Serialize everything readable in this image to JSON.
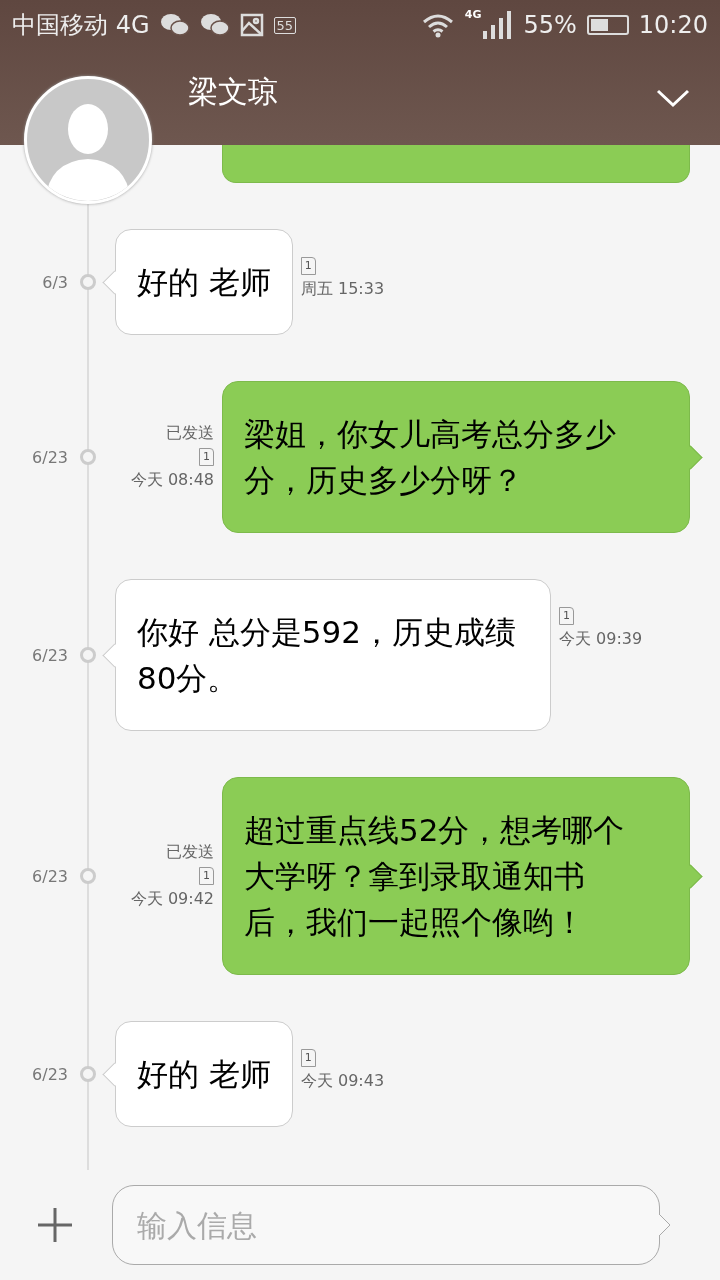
{
  "status_bar": {
    "carrier": "中国移动 4G",
    "notification_badge": "55",
    "network": "4G",
    "battery": "55%",
    "time": "10:20"
  },
  "header": {
    "contact_name": "梁文琼"
  },
  "messages": [
    {
      "kind": "received",
      "date": "6/3",
      "text": "好的 老师",
      "sim": "1",
      "time": "周五 15:33"
    },
    {
      "kind": "sent",
      "date": "6/23",
      "status": "已发送",
      "text": "梁姐，你女儿高考总分多少分，历史多少分呀？",
      "sim": "1",
      "time": "今天 08:48"
    },
    {
      "kind": "received",
      "date": "6/23",
      "text": "你好 总分是592，历史成绩80分。",
      "sim": "1",
      "time": "今天 09:39"
    },
    {
      "kind": "sent",
      "date": "6/23",
      "status": "已发送",
      "text": "超过重点线52分，想考哪个大学呀？拿到录取通知书后，我们一起照个像哟！",
      "sim": "1",
      "time": "今天 09:42"
    },
    {
      "kind": "received",
      "date": "6/23",
      "text": "好的 老师",
      "sim": "1",
      "time": "今天 09:43"
    }
  ],
  "composer": {
    "placeholder": "输入信息"
  }
}
